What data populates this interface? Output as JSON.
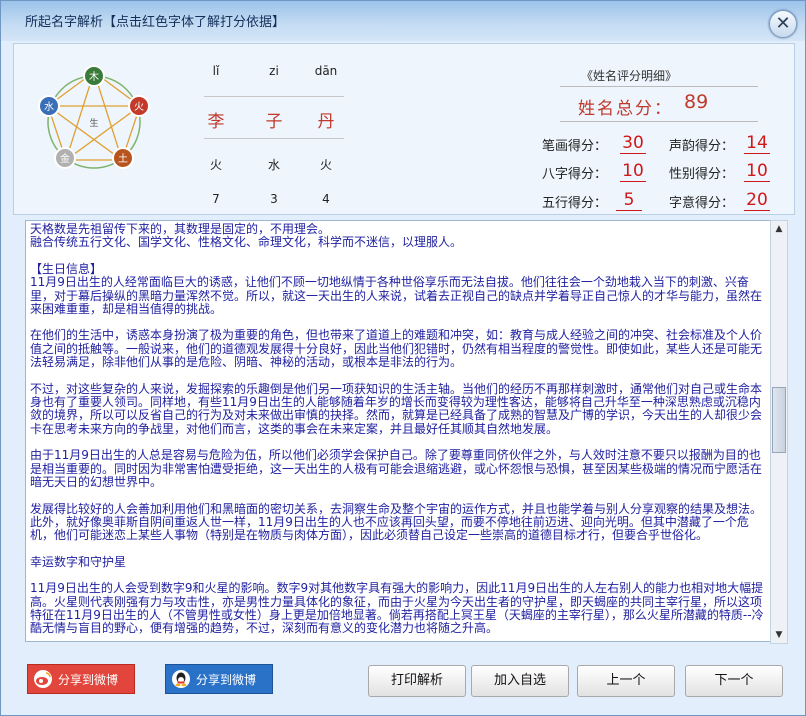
{
  "window": {
    "title": "所起名字解析【点击红色字体了解打分依据】"
  },
  "wuxing": {
    "nodes": [
      "木",
      "火",
      "土",
      "金",
      "水"
    ],
    "center": "生"
  },
  "name": {
    "chars": [
      {
        "pinyin": "lǐ",
        "char": "李",
        "element": "火",
        "strokes": "7"
      },
      {
        "pinyin": "zi",
        "char": "子",
        "element": "水",
        "strokes": "3"
      },
      {
        "pinyin": "dān",
        "char": "丹",
        "element": "火",
        "strokes": "4"
      }
    ]
  },
  "score": {
    "title": "《姓名评分明细》",
    "total_label": "姓名总分：",
    "total_value": "89",
    "items": [
      {
        "label": "笔画得分：",
        "value": "30"
      },
      {
        "label": "声韵得分：",
        "value": "14"
      },
      {
        "label": "八字得分：",
        "value": "10"
      },
      {
        "label": "性别得分：",
        "value": "10"
      },
      {
        "label": "五行得分：",
        "value": "5"
      },
      {
        "label": "字意得分：",
        "value": "20"
      }
    ]
  },
  "analysis": {
    "paragraphs": [
      "天格数是先祖留传下来的，其数理是固定的，不用理会。\n融合传统五行文化、国学文化、性格文化、命理文化，科学而不迷信，以理服人。",
      "【生日信息】\n11月9日出生的人经常面临巨大的诱惑，让他们不顾一切地纵情于各种世俗享乐而无法自拔。他们往往会一个劲地栽入当下的刺激、兴奋里，对于幕后操纵的黑暗力量浑然不觉。所以，就这一天出生的人来说，试着去正视自己的缺点并学着导正自己惊人的才华与能力，虽然在来困难重重，却是相当值得的挑战。",
      "在他们的生活中，诱惑本身扮演了极为重要的角色，但也带来了道道上的难题和冲突，如：教育与成人经验之间的冲突、社会标准及个人价值之间的抵触等。一般说来，他们的道德观发展得十分良好，因此当他们犯错时，仍然有相当程度的警觉性。即使如此，某些人还是可能无法轻易满足，除非他们从事的是危险、阴暗、神秘的活动，或根本是非法的行为。",
      "不过，对这些复杂的人来说，发掘探索的乐趣倒是他们另一项获知识的生活主轴。当他们的经历不再那样刺激时，通常他们对自己或生命本身也有了重要人领司。同样地，有些11月9日出生的人能够随着年岁的增长而变得较为理性客达，能够将自己升华至一种深思熟虑或沉稳内敛的境界，所以可以反省自己的行为及对未来做出审慎的抉择。然而，就算是已经具备了成熟的智慧及广博的学识，今天出生的人却很少会卡在思考未来方向的争战里，对他们而言，这类的事会在未来定案，并且最好任其顺其自然地发展。",
      "由于11月9日出生的人总是容易与危险为伍，所以他们必须学会保护自己。除了要尊重同侪伙伴之外，与人效时注意不要只以报酬为目的也是相当重要的。同时因为非常害怕遭受拒绝，这一天出生的人极有可能会退缩逃避，或心怀怨恨与恐惧，甚至因某些极端的情况而宁愿活在暗无天日的幻想世界中。",
      "发展得比较好的人会善加利用他们和黑暗面的密切关系，去洞察生命及整个宇宙的运作方式，并且也能学着与别人分享观察的结果及想法。此外，就好像奥菲斯自阴间重返人世一样，11月9日出生的人也不应该再回头望，而要不停地往前迈进、迎向光明。但其中潜藏了一个危机，他们可能迷恋上某些人事物（特别是在物质与肉体方面），因此必须替自己设定一些崇高的道德目标才行，但要合乎世俗化。",
      "幸运数字和守护星",
      "11月9日出生的人会受到数字9和火星的影响。数字9对其他数字具有强大的影响力，因此11月9日出生的人左右别人的能力也相对地大幅提高。火星则代表刚强有力与攻击性，亦是男性力量具体化的象征，而由于火星为今天出生者的守护星，即天蝎座的共同主宰行星，所以这项特征在11月9日出生的人（不管男性或女性）身上更是加倍地显著。倘若再搭配上冥王星（天蝎座的主宰行星），那么火星所潜藏的特质--冷酷无情与盲目的野心，便有增强的趋势，不过，深刻而有意义的变化潜力也将随之升高。"
    ]
  },
  "buttons": {
    "weibo": "分享到微博",
    "qq": "分享到微博",
    "print": "打印解析",
    "add": "加入自选",
    "prev": "上一个",
    "next": "下一个"
  }
}
